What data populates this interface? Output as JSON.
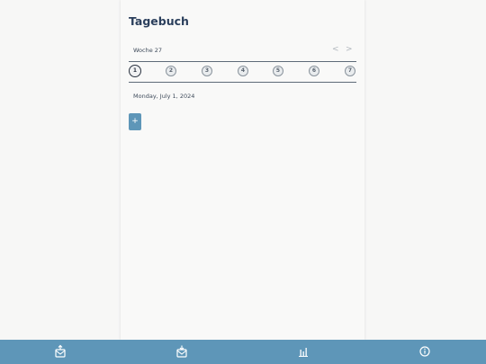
{
  "header": {
    "title": "Tagebuch"
  },
  "week": {
    "label": "Woche 27",
    "prev_glyph": "<",
    "next_glyph": ">"
  },
  "days": {
    "items": [
      "1",
      "2",
      "3",
      "4",
      "5",
      "6",
      "7"
    ],
    "selected": "1"
  },
  "entry": {
    "date": "Monday, July 1, 2024",
    "add_label": "+"
  },
  "bottom_nav": {
    "tabs": [
      {
        "icon": "journal-export-icon"
      },
      {
        "icon": "journal-import-icon"
      },
      {
        "icon": "bar-chart-icon"
      },
      {
        "icon": "info-icon"
      }
    ]
  },
  "colors": {
    "accent": "#5e96b8",
    "title": "#2b3f5c",
    "background": "#f7f7f6"
  }
}
